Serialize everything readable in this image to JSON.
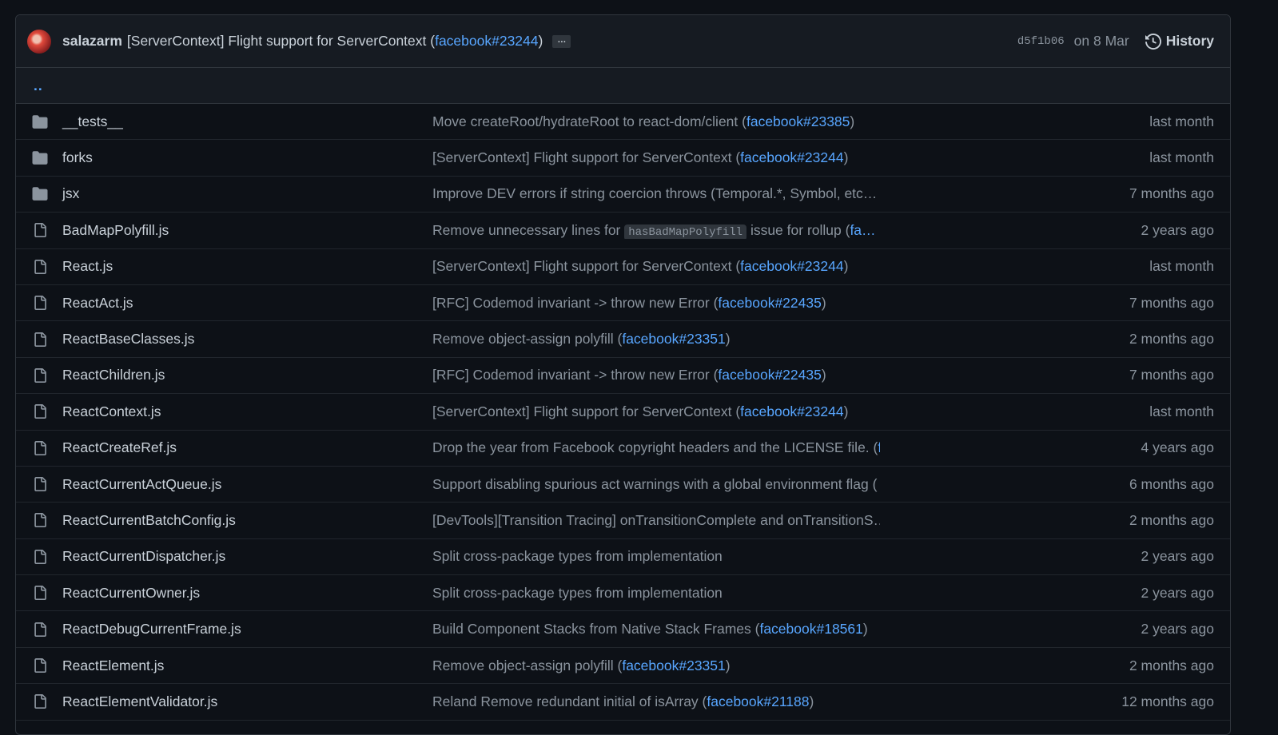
{
  "commit": {
    "author": "salazarm",
    "message": "[ServerContext] Flight support for ServerContext (",
    "link": "facebook#23244",
    "message_end": ")",
    "ellipsis": "…",
    "sha": "d5f1b06",
    "date": "on 8 Mar",
    "history_label": "History"
  },
  "parent_dir": "..",
  "rows": [
    {
      "type": "folder",
      "name": "__tests__",
      "pre": "Move createRoot/hydrateRoot to react-dom/client (",
      "link": "facebook#23385",
      "post": ")",
      "age": "last month"
    },
    {
      "type": "folder",
      "name": "forks",
      "pre": "[ServerContext] Flight support for ServerContext (",
      "link": "facebook#23244",
      "post": ")",
      "age": "last month"
    },
    {
      "type": "folder",
      "name": "jsx",
      "pre": "Improve DEV errors if string coercion throws (Temporal.*, Symbol, etc…",
      "link": "",
      "post": "",
      "age": "7 months ago"
    },
    {
      "type": "file",
      "name": "BadMapPolyfill.js",
      "pre": "Remove unnecessary lines for ",
      "code": "hasBadMapPolyfill",
      "mid": " issue for rollup (",
      "link": "fa…",
      "post": "",
      "age": "2 years ago"
    },
    {
      "type": "file",
      "name": "React.js",
      "pre": "[ServerContext] Flight support for ServerContext (",
      "link": "facebook#23244",
      "post": ")",
      "age": "last month"
    },
    {
      "type": "file",
      "name": "ReactAct.js",
      "pre": "[RFC] Codemod invariant -> throw new Error (",
      "link": "facebook#22435",
      "post": ")",
      "age": "7 months ago"
    },
    {
      "type": "file",
      "name": "ReactBaseClasses.js",
      "pre": "Remove object-assign polyfill (",
      "link": "facebook#23351",
      "post": ")",
      "age": "2 months ago"
    },
    {
      "type": "file",
      "name": "ReactChildren.js",
      "pre": "[RFC] Codemod invariant -> throw new Error (",
      "link": "facebook#22435",
      "post": ")",
      "age": "7 months ago"
    },
    {
      "type": "file",
      "name": "ReactContext.js",
      "pre": "[ServerContext] Flight support for ServerContext (",
      "link": "facebook#23244",
      "post": ")",
      "age": "last month"
    },
    {
      "type": "file",
      "name": "ReactCreateRef.js",
      "pre": "Drop the year from Facebook copyright headers and the LICENSE file. (",
      "link": "f…",
      "post": "",
      "age": "4 years ago"
    },
    {
      "type": "file",
      "name": "ReactCurrentActQueue.js",
      "pre": "Support disabling spurious act warnings with a global environment flag (",
      "link": "",
      "post": "",
      "age": "6 months ago"
    },
    {
      "type": "file",
      "name": "ReactCurrentBatchConfig.js",
      "pre": "[DevTools][Transition Tracing] onTransitionComplete and onTransitionS…",
      "link": "",
      "post": "",
      "age": "2 months ago"
    },
    {
      "type": "file",
      "name": "ReactCurrentDispatcher.js",
      "pre": "Split cross-package types from implementation",
      "link": "",
      "post": "",
      "age": "2 years ago"
    },
    {
      "type": "file",
      "name": "ReactCurrentOwner.js",
      "pre": "Split cross-package types from implementation",
      "link": "",
      "post": "",
      "age": "2 years ago"
    },
    {
      "type": "file",
      "name": "ReactDebugCurrentFrame.js",
      "pre": "Build Component Stacks from Native Stack Frames (",
      "link": "facebook#18561",
      "post": ")",
      "age": "2 years ago"
    },
    {
      "type": "file",
      "name": "ReactElement.js",
      "pre": "Remove object-assign polyfill (",
      "link": "facebook#23351",
      "post": ")",
      "age": "2 months ago"
    },
    {
      "type": "file",
      "name": "ReactElementValidator.js",
      "pre": "Reland Remove redundant initial of isArray (",
      "link": "facebook#21188",
      "post": ")",
      "age": "12 months ago"
    }
  ]
}
